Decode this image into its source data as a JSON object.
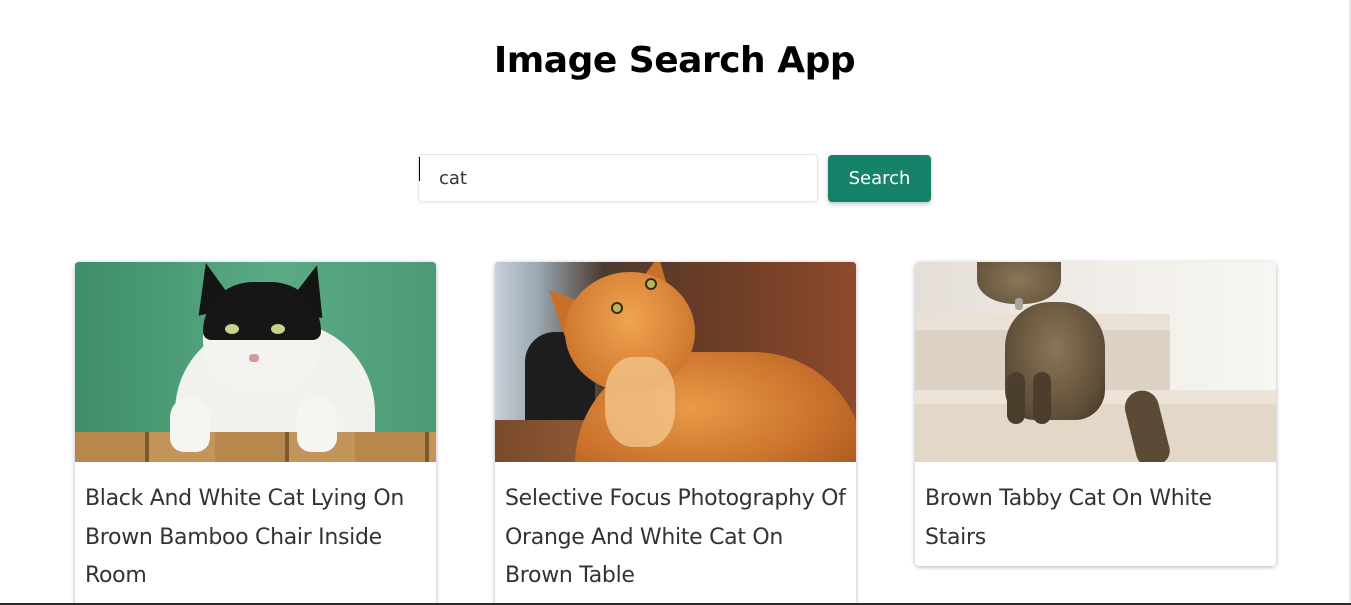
{
  "app": {
    "title": "Image Search App"
  },
  "search": {
    "value": "cat",
    "button_label": "Search"
  },
  "results": [
    {
      "caption": "Black And White Cat Lying On Brown Bamboo Chair Inside Room"
    },
    {
      "caption": "Selective Focus Photography Of Orange And White Cat On Brown Table"
    },
    {
      "caption": "Brown Tabby Cat On White Stairs"
    }
  ],
  "colors": {
    "accent": "#17826a",
    "background": "#ffffff",
    "text": "#333333"
  }
}
